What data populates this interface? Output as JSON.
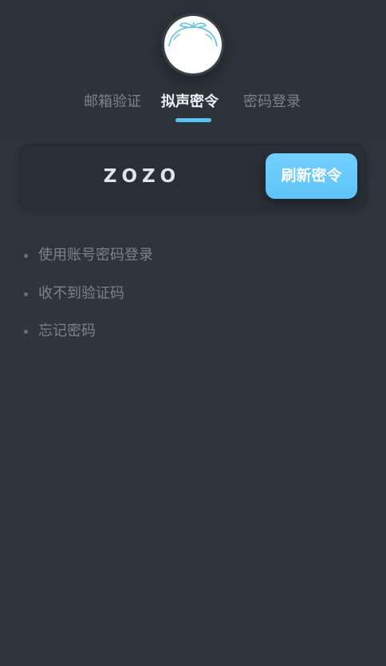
{
  "avatar": {
    "icon": "orange-fruit-avatar"
  },
  "tabs": [
    {
      "label": "邮箱验证",
      "active": false
    },
    {
      "label": "拟声密令",
      "active": true
    },
    {
      "label": "密码登录",
      "active": false
    }
  ],
  "code_card": {
    "code": "ZOZO",
    "refresh_label": "刷新密令"
  },
  "links": [
    {
      "label": "使用账号密码登录"
    },
    {
      "label": "收不到验证码"
    },
    {
      "label": "忘记密码"
    }
  ],
  "colors": {
    "background": "#303640",
    "accent": "#5ec4f6",
    "text_muted": "#7c828c",
    "text_active": "#eef1f6"
  }
}
